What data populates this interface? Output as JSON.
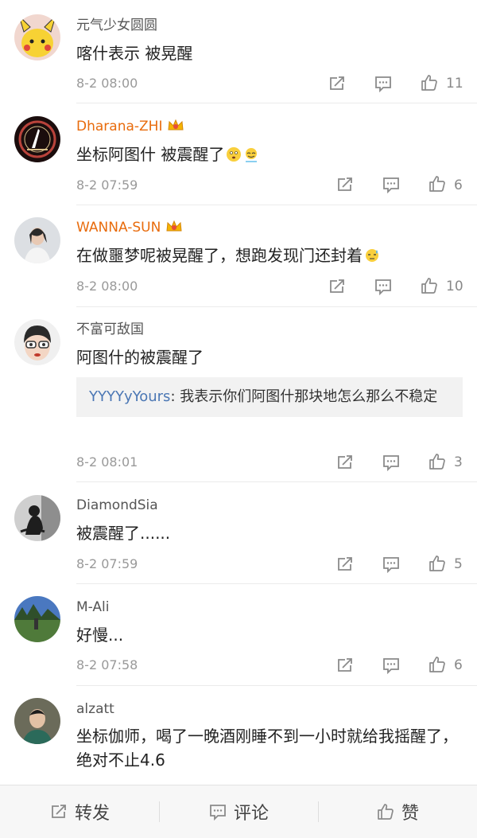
{
  "comments": [
    {
      "username": "元气少女圆圆",
      "text": "喀什表示 被晃醒",
      "time": "8-2 08:00",
      "likes": "11"
    },
    {
      "username": "Dharana-ZHI",
      "text": "坐标阿图什  被震醒了",
      "time": "8-2 07:59",
      "likes": "6"
    },
    {
      "username": "WANNA-SUN",
      "text": "在做噩梦呢被晃醒了，想跑发现门还封着",
      "time": "8-2 08:00",
      "likes": "10"
    },
    {
      "username": "不富可敌国",
      "text": "阿图什的被震醒了",
      "reply_user": "YYYYyYours",
      "reply_text": ": 我表示你们阿图什那块地怎么那么不稳定",
      "time": "8-2 08:01",
      "likes": "3"
    },
    {
      "username": "DiamondSia",
      "text": "被震醒了......",
      "time": "8-2 07:59",
      "likes": "5"
    },
    {
      "username": "M-Ali",
      "text": "好慢...",
      "time": "8-2 07:58",
      "likes": "6"
    },
    {
      "username": "alzatt",
      "text": "坐标伽师，喝了一晚酒刚睡不到一小时就给我摇醒了，绝对不止4.6"
    }
  ],
  "bottom_bar": {
    "repost": "转发",
    "comment": "评论",
    "like": "赞"
  },
  "colors": {
    "vip_name": "#e86b0c",
    "reply_user": "#4b77b4",
    "meta": "#999999"
  }
}
